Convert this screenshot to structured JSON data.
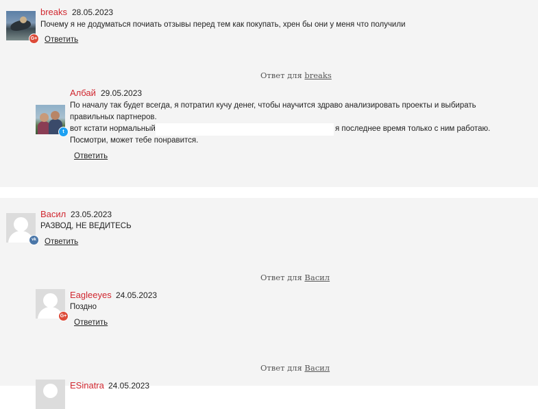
{
  "comments": {
    "breaks": {
      "author": "breaks",
      "date": "28.05.2023",
      "text": "Почему я не додуматься почиать отзывы перед тем как покупать, хрен бы они у меня что получили",
      "reply": "Ответить",
      "badge_icon": "google-plus-icon",
      "badge_label": "G+",
      "badge_color": "#dd4b39"
    },
    "albay": {
      "reply_for_prefix": "Ответ для",
      "reply_for_target": "breaks",
      "author": "Албай",
      "date": "29.05.2023",
      "text_line1": "По началу так будет всегда, я потратил кучу денег, чтобы научится здраво анализировать проекты и выбирать",
      "text_line2": "правильных партнеров.",
      "text_line3_start": "вот кстати нормальный",
      "text_line3_end": "я последнее время только с ним работаю.",
      "text_line4": "Посмотри, может тебе понравится.",
      "reply": "Ответить",
      "badge_icon": "twitter-icon",
      "badge_label": "t",
      "badge_color": "#1da1f2"
    },
    "vasil": {
      "author": "Васил",
      "date": "23.05.2023",
      "text": "РАЗВОД, НЕ ВЕДИТЕСЬ",
      "reply": "Ответить",
      "badge_icon": "vk-icon",
      "badge_label": "vk",
      "badge_color": "#4a76a8"
    },
    "eagleeyes": {
      "reply_for_prefix": "Ответ для",
      "reply_for_target": "Васил",
      "author": "Eagleeyes",
      "date": "24.05.2023",
      "text": "Поздно",
      "reply": "Ответить",
      "badge_icon": "google-plus-icon",
      "badge_label": "G+",
      "badge_color": "#dd4b39"
    },
    "esinatra": {
      "reply_for_prefix": "Ответ для",
      "reply_for_target": "Васил",
      "author": "ESinatra",
      "date": "24.05.2023"
    }
  },
  "colors": {
    "author": "#d0262e",
    "block_background": "#f4f4f4"
  }
}
